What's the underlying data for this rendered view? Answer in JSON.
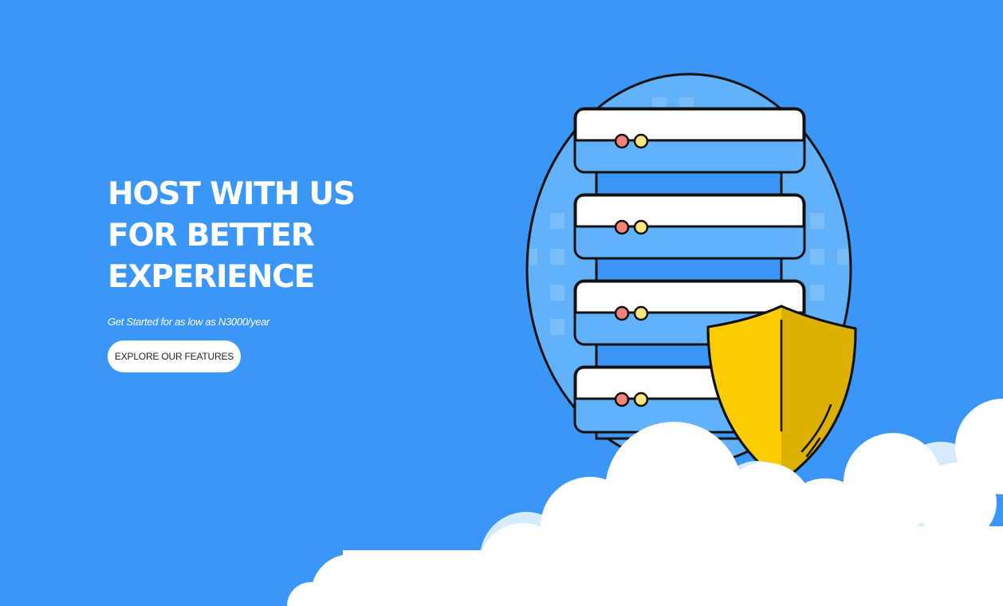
{
  "hero": {
    "headline_line1": "HOST WITH US",
    "headline_line2": "FOR BETTER",
    "headline_line3": "EXPERIENCE",
    "subtitle": "Get Started for as low as N3000/year",
    "cta_label": "EXPLORE OUR FEATURES"
  },
  "illustration": {
    "icons": [
      "server-rack-icon",
      "security-shield-icon",
      "cloud-icon"
    ]
  },
  "colors": {
    "background": "#3a97f7",
    "server_light": "#62b2fb",
    "shield_yellow": "#fccb00",
    "shield_shade": "#dbb000",
    "led_red": "#f5827a",
    "led_yellow": "#fae57f",
    "cloud": "#ffffff"
  }
}
